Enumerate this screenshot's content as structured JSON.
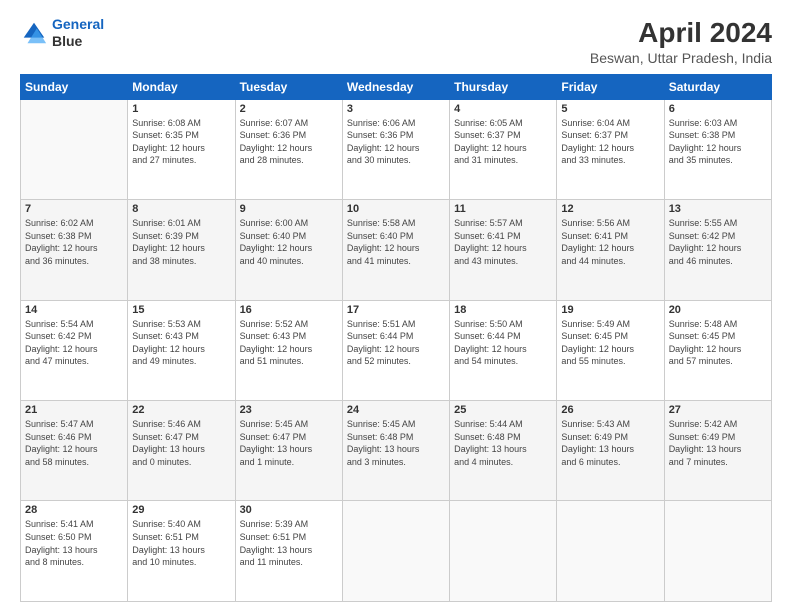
{
  "header": {
    "logo_line1": "General",
    "logo_line2": "Blue",
    "title": "April 2024",
    "subtitle": "Beswan, Uttar Pradesh, India"
  },
  "columns": [
    "Sunday",
    "Monday",
    "Tuesday",
    "Wednesday",
    "Thursday",
    "Friday",
    "Saturday"
  ],
  "weeks": [
    {
      "shade": false,
      "days": [
        {
          "num": "",
          "info": ""
        },
        {
          "num": "1",
          "info": "Sunrise: 6:08 AM\nSunset: 6:35 PM\nDaylight: 12 hours\nand 27 minutes."
        },
        {
          "num": "2",
          "info": "Sunrise: 6:07 AM\nSunset: 6:36 PM\nDaylight: 12 hours\nand 28 minutes."
        },
        {
          "num": "3",
          "info": "Sunrise: 6:06 AM\nSunset: 6:36 PM\nDaylight: 12 hours\nand 30 minutes."
        },
        {
          "num": "4",
          "info": "Sunrise: 6:05 AM\nSunset: 6:37 PM\nDaylight: 12 hours\nand 31 minutes."
        },
        {
          "num": "5",
          "info": "Sunrise: 6:04 AM\nSunset: 6:37 PM\nDaylight: 12 hours\nand 33 minutes."
        },
        {
          "num": "6",
          "info": "Sunrise: 6:03 AM\nSunset: 6:38 PM\nDaylight: 12 hours\nand 35 minutes."
        }
      ]
    },
    {
      "shade": true,
      "days": [
        {
          "num": "7",
          "info": "Sunrise: 6:02 AM\nSunset: 6:38 PM\nDaylight: 12 hours\nand 36 minutes."
        },
        {
          "num": "8",
          "info": "Sunrise: 6:01 AM\nSunset: 6:39 PM\nDaylight: 12 hours\nand 38 minutes."
        },
        {
          "num": "9",
          "info": "Sunrise: 6:00 AM\nSunset: 6:40 PM\nDaylight: 12 hours\nand 40 minutes."
        },
        {
          "num": "10",
          "info": "Sunrise: 5:58 AM\nSunset: 6:40 PM\nDaylight: 12 hours\nand 41 minutes."
        },
        {
          "num": "11",
          "info": "Sunrise: 5:57 AM\nSunset: 6:41 PM\nDaylight: 12 hours\nand 43 minutes."
        },
        {
          "num": "12",
          "info": "Sunrise: 5:56 AM\nSunset: 6:41 PM\nDaylight: 12 hours\nand 44 minutes."
        },
        {
          "num": "13",
          "info": "Sunrise: 5:55 AM\nSunset: 6:42 PM\nDaylight: 12 hours\nand 46 minutes."
        }
      ]
    },
    {
      "shade": false,
      "days": [
        {
          "num": "14",
          "info": "Sunrise: 5:54 AM\nSunset: 6:42 PM\nDaylight: 12 hours\nand 47 minutes."
        },
        {
          "num": "15",
          "info": "Sunrise: 5:53 AM\nSunset: 6:43 PM\nDaylight: 12 hours\nand 49 minutes."
        },
        {
          "num": "16",
          "info": "Sunrise: 5:52 AM\nSunset: 6:43 PM\nDaylight: 12 hours\nand 51 minutes."
        },
        {
          "num": "17",
          "info": "Sunrise: 5:51 AM\nSunset: 6:44 PM\nDaylight: 12 hours\nand 52 minutes."
        },
        {
          "num": "18",
          "info": "Sunrise: 5:50 AM\nSunset: 6:44 PM\nDaylight: 12 hours\nand 54 minutes."
        },
        {
          "num": "19",
          "info": "Sunrise: 5:49 AM\nSunset: 6:45 PM\nDaylight: 12 hours\nand 55 minutes."
        },
        {
          "num": "20",
          "info": "Sunrise: 5:48 AM\nSunset: 6:45 PM\nDaylight: 12 hours\nand 57 minutes."
        }
      ]
    },
    {
      "shade": true,
      "days": [
        {
          "num": "21",
          "info": "Sunrise: 5:47 AM\nSunset: 6:46 PM\nDaylight: 12 hours\nand 58 minutes."
        },
        {
          "num": "22",
          "info": "Sunrise: 5:46 AM\nSunset: 6:47 PM\nDaylight: 13 hours\nand 0 minutes."
        },
        {
          "num": "23",
          "info": "Sunrise: 5:45 AM\nSunset: 6:47 PM\nDaylight: 13 hours\nand 1 minute."
        },
        {
          "num": "24",
          "info": "Sunrise: 5:45 AM\nSunset: 6:48 PM\nDaylight: 13 hours\nand 3 minutes."
        },
        {
          "num": "25",
          "info": "Sunrise: 5:44 AM\nSunset: 6:48 PM\nDaylight: 13 hours\nand 4 minutes."
        },
        {
          "num": "26",
          "info": "Sunrise: 5:43 AM\nSunset: 6:49 PM\nDaylight: 13 hours\nand 6 minutes."
        },
        {
          "num": "27",
          "info": "Sunrise: 5:42 AM\nSunset: 6:49 PM\nDaylight: 13 hours\nand 7 minutes."
        }
      ]
    },
    {
      "shade": false,
      "days": [
        {
          "num": "28",
          "info": "Sunrise: 5:41 AM\nSunset: 6:50 PM\nDaylight: 13 hours\nand 8 minutes."
        },
        {
          "num": "29",
          "info": "Sunrise: 5:40 AM\nSunset: 6:51 PM\nDaylight: 13 hours\nand 10 minutes."
        },
        {
          "num": "30",
          "info": "Sunrise: 5:39 AM\nSunset: 6:51 PM\nDaylight: 13 hours\nand 11 minutes."
        },
        {
          "num": "",
          "info": ""
        },
        {
          "num": "",
          "info": ""
        },
        {
          "num": "",
          "info": ""
        },
        {
          "num": "",
          "info": ""
        }
      ]
    }
  ]
}
